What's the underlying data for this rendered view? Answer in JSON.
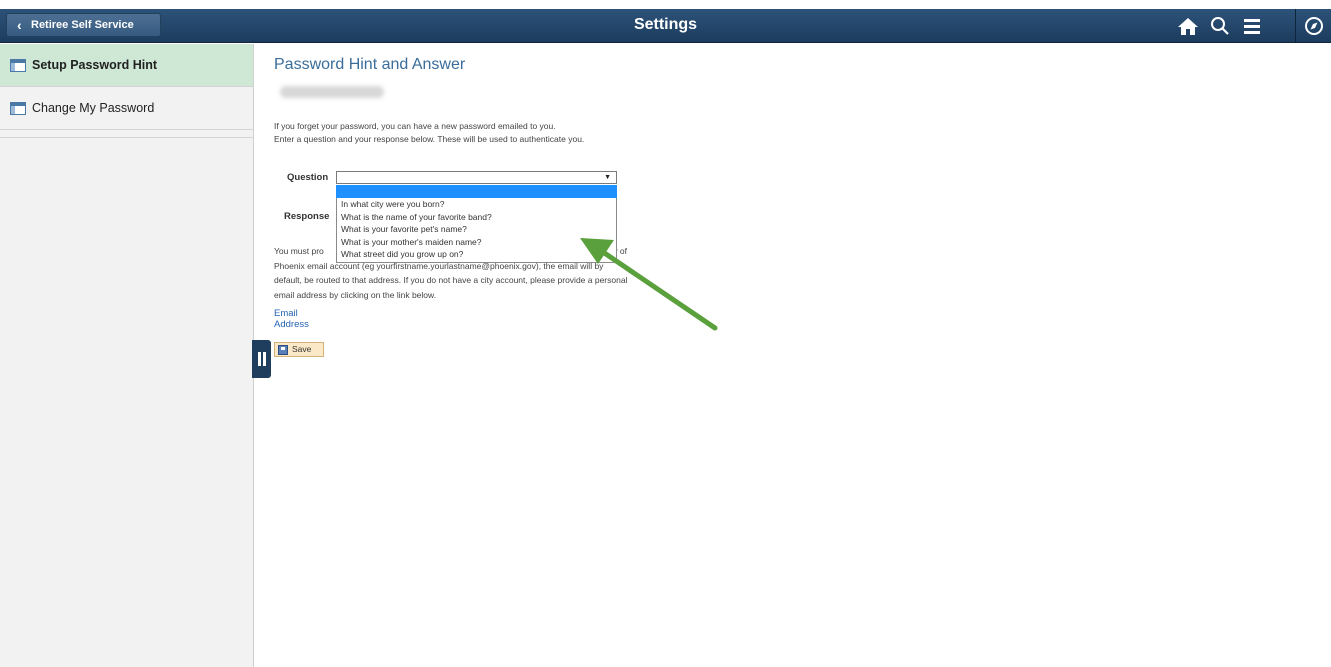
{
  "header": {
    "back_label": "Retiree Self Service",
    "title": "Settings",
    "icons": [
      "home-icon",
      "search-icon",
      "menu-icon",
      "navbar-compass-icon"
    ]
  },
  "sidebar": {
    "items": [
      {
        "label": "Setup Password Hint",
        "active": true
      },
      {
        "label": "Change My Password",
        "active": false
      }
    ]
  },
  "main": {
    "heading": "Password Hint and Answer",
    "info_line1": "If you forget your password, you can have a new password emailed to you.",
    "info_line2": "Enter a question and your response below. These will be used to authenticate you.",
    "question_label": "Question",
    "response_label": "Response",
    "select_value": "",
    "options": [
      "In what city were you born?",
      "What is the name of your favorite band?",
      "What is your favorite pet's name?",
      "What is your mother's maiden name?",
      "What street did you grow up on?"
    ],
    "para_line1_start": "You must pro",
    "para_line1_end": "ave a City of",
    "para_line2": "Phoenix email account (eg yourfirstname.yourlastname@phoenix.gov), the email will by",
    "para_line3": "default, be routed to that address. If you do not have a city account, please provide a personal",
    "para_line4": "email address by clicking on the link below.",
    "email_link": "Email Address",
    "save_label": "Save"
  },
  "colors": {
    "header_bg": "#1f3f60",
    "active_item_bg": "#cfe7d5",
    "heading_color": "#3a6d9a",
    "link_color": "#2563b2",
    "dropdown_highlight": "#1e90ff",
    "arrow_color": "#5aa03c"
  }
}
